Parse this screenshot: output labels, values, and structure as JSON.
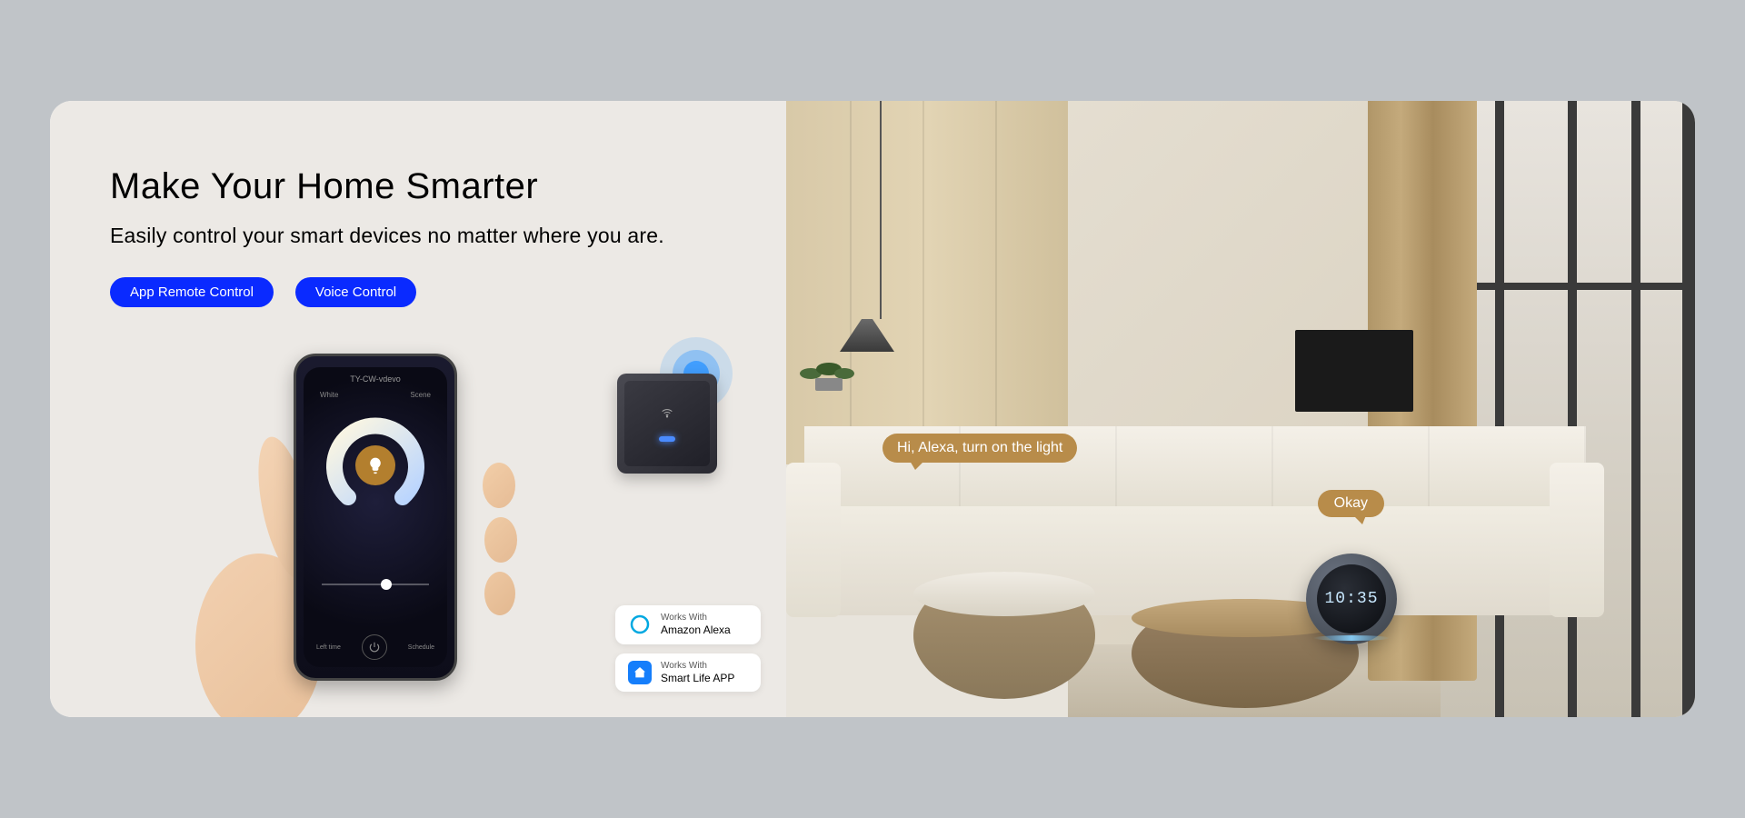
{
  "heading": "Make Your Home Smarter",
  "subheading": "Easily control your smart devices no matter where you are.",
  "buttons": {
    "app_remote": "App Remote Control",
    "voice": "Voice Control"
  },
  "phone": {
    "title": "TY-CW-vdevo",
    "tab_left": "White",
    "tab_right": "Scene",
    "bottom_left": "Left time",
    "bottom_right": "Schedule"
  },
  "badges": {
    "works_with": "Works With",
    "alexa": "Amazon Alexa",
    "smartlife": "Smart Life APP"
  },
  "speech": {
    "command": "Hi, Alexa, turn on the light",
    "response": "Okay"
  },
  "echo": {
    "time": "10:35"
  }
}
